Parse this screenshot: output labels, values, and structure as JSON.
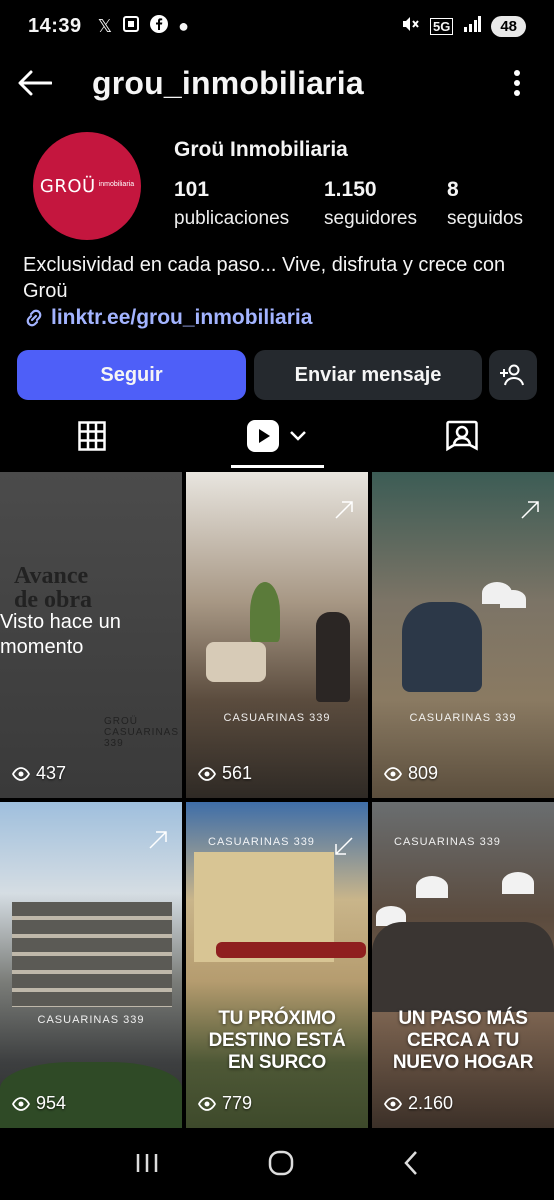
{
  "status_bar": {
    "time": "14:39",
    "left_icons": [
      "x-icon",
      "screenshot-icon",
      "facebook-icon",
      "dot-icon"
    ],
    "network": "5G",
    "battery": "48"
  },
  "header": {
    "username": "grou_inmobiliaria"
  },
  "profile": {
    "avatar_text": "GROÜ",
    "avatar_subtext": "inmobiliaria",
    "display_name": "Groü Inmobiliaria",
    "stats": [
      {
        "num": "101",
        "label": "publicaciones"
      },
      {
        "num": "1.150",
        "label": "seguidores"
      },
      {
        "num": "8",
        "label": "seguidos"
      }
    ],
    "bio": "Exclusividad en cada paso... Vive, disfruta y crece con Groü",
    "link": "linktr.ee/grou_inmobiliaria"
  },
  "actions": {
    "follow": "Seguir",
    "message": "Enviar mensaje"
  },
  "colors": {
    "accent": "#4e5ff8",
    "avatar": "#c4163e",
    "link": "#a3b4ff"
  },
  "grid": {
    "tiles": [
      {
        "views": "437",
        "title": "Avance de obra",
        "overlay": "Visto hace un momento",
        "brand": "GROÜ CASUARINAS 339"
      },
      {
        "views": "561",
        "brand": "CASUARINAS 339"
      },
      {
        "views": "809",
        "brand": "CASUARINAS 339"
      },
      {
        "views": "954",
        "brand": "CASUARINAS 339"
      },
      {
        "views": "779",
        "brand": "CASUARINAS 339",
        "headline": "TU PRÓXIMO DESTINO ESTÁ EN SURCO"
      },
      {
        "views": "2.160",
        "brand": "CASUARINAS 339",
        "headline": "UN PASO MÁS CERCA A TU NUEVO HOGAR"
      }
    ]
  }
}
